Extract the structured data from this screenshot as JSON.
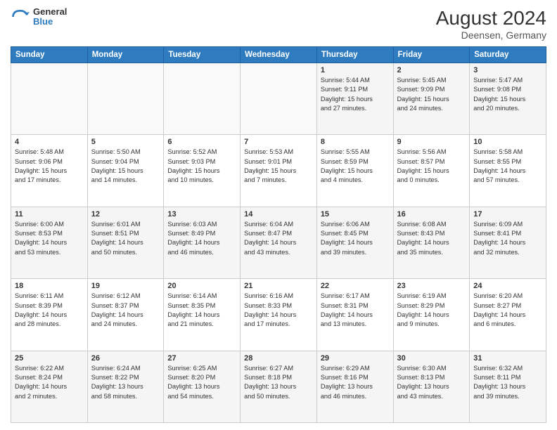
{
  "header": {
    "logo_line1": "General",
    "logo_line2": "Blue",
    "title": "August 2024",
    "subtitle": "Deensen, Germany"
  },
  "calendar": {
    "days_of_week": [
      "Sunday",
      "Monday",
      "Tuesday",
      "Wednesday",
      "Thursday",
      "Friday",
      "Saturday"
    ],
    "weeks": [
      [
        {
          "day": "",
          "info": ""
        },
        {
          "day": "",
          "info": ""
        },
        {
          "day": "",
          "info": ""
        },
        {
          "day": "",
          "info": ""
        },
        {
          "day": "1",
          "info": "Sunrise: 5:44 AM\nSunset: 9:11 PM\nDaylight: 15 hours\nand 27 minutes."
        },
        {
          "day": "2",
          "info": "Sunrise: 5:45 AM\nSunset: 9:09 PM\nDaylight: 15 hours\nand 24 minutes."
        },
        {
          "day": "3",
          "info": "Sunrise: 5:47 AM\nSunset: 9:08 PM\nDaylight: 15 hours\nand 20 minutes."
        }
      ],
      [
        {
          "day": "4",
          "info": "Sunrise: 5:48 AM\nSunset: 9:06 PM\nDaylight: 15 hours\nand 17 minutes."
        },
        {
          "day": "5",
          "info": "Sunrise: 5:50 AM\nSunset: 9:04 PM\nDaylight: 15 hours\nand 14 minutes."
        },
        {
          "day": "6",
          "info": "Sunrise: 5:52 AM\nSunset: 9:03 PM\nDaylight: 15 hours\nand 10 minutes."
        },
        {
          "day": "7",
          "info": "Sunrise: 5:53 AM\nSunset: 9:01 PM\nDaylight: 15 hours\nand 7 minutes."
        },
        {
          "day": "8",
          "info": "Sunrise: 5:55 AM\nSunset: 8:59 PM\nDaylight: 15 hours\nand 4 minutes."
        },
        {
          "day": "9",
          "info": "Sunrise: 5:56 AM\nSunset: 8:57 PM\nDaylight: 15 hours\nand 0 minutes."
        },
        {
          "day": "10",
          "info": "Sunrise: 5:58 AM\nSunset: 8:55 PM\nDaylight: 14 hours\nand 57 minutes."
        }
      ],
      [
        {
          "day": "11",
          "info": "Sunrise: 6:00 AM\nSunset: 8:53 PM\nDaylight: 14 hours\nand 53 minutes."
        },
        {
          "day": "12",
          "info": "Sunrise: 6:01 AM\nSunset: 8:51 PM\nDaylight: 14 hours\nand 50 minutes."
        },
        {
          "day": "13",
          "info": "Sunrise: 6:03 AM\nSunset: 8:49 PM\nDaylight: 14 hours\nand 46 minutes."
        },
        {
          "day": "14",
          "info": "Sunrise: 6:04 AM\nSunset: 8:47 PM\nDaylight: 14 hours\nand 43 minutes."
        },
        {
          "day": "15",
          "info": "Sunrise: 6:06 AM\nSunset: 8:45 PM\nDaylight: 14 hours\nand 39 minutes."
        },
        {
          "day": "16",
          "info": "Sunrise: 6:08 AM\nSunset: 8:43 PM\nDaylight: 14 hours\nand 35 minutes."
        },
        {
          "day": "17",
          "info": "Sunrise: 6:09 AM\nSunset: 8:41 PM\nDaylight: 14 hours\nand 32 minutes."
        }
      ],
      [
        {
          "day": "18",
          "info": "Sunrise: 6:11 AM\nSunset: 8:39 PM\nDaylight: 14 hours\nand 28 minutes."
        },
        {
          "day": "19",
          "info": "Sunrise: 6:12 AM\nSunset: 8:37 PM\nDaylight: 14 hours\nand 24 minutes."
        },
        {
          "day": "20",
          "info": "Sunrise: 6:14 AM\nSunset: 8:35 PM\nDaylight: 14 hours\nand 21 minutes."
        },
        {
          "day": "21",
          "info": "Sunrise: 6:16 AM\nSunset: 8:33 PM\nDaylight: 14 hours\nand 17 minutes."
        },
        {
          "day": "22",
          "info": "Sunrise: 6:17 AM\nSunset: 8:31 PM\nDaylight: 14 hours\nand 13 minutes."
        },
        {
          "day": "23",
          "info": "Sunrise: 6:19 AM\nSunset: 8:29 PM\nDaylight: 14 hours\nand 9 minutes."
        },
        {
          "day": "24",
          "info": "Sunrise: 6:20 AM\nSunset: 8:27 PM\nDaylight: 14 hours\nand 6 minutes."
        }
      ],
      [
        {
          "day": "25",
          "info": "Sunrise: 6:22 AM\nSunset: 8:24 PM\nDaylight: 14 hours\nand 2 minutes."
        },
        {
          "day": "26",
          "info": "Sunrise: 6:24 AM\nSunset: 8:22 PM\nDaylight: 13 hours\nand 58 minutes."
        },
        {
          "day": "27",
          "info": "Sunrise: 6:25 AM\nSunset: 8:20 PM\nDaylight: 13 hours\nand 54 minutes."
        },
        {
          "day": "28",
          "info": "Sunrise: 6:27 AM\nSunset: 8:18 PM\nDaylight: 13 hours\nand 50 minutes."
        },
        {
          "day": "29",
          "info": "Sunrise: 6:29 AM\nSunset: 8:16 PM\nDaylight: 13 hours\nand 46 minutes."
        },
        {
          "day": "30",
          "info": "Sunrise: 6:30 AM\nSunset: 8:13 PM\nDaylight: 13 hours\nand 43 minutes."
        },
        {
          "day": "31",
          "info": "Sunrise: 6:32 AM\nSunset: 8:11 PM\nDaylight: 13 hours\nand 39 minutes."
        }
      ]
    ]
  }
}
